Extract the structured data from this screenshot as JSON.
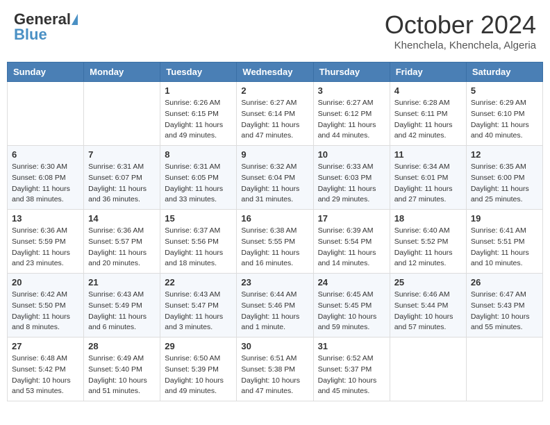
{
  "header": {
    "logo_general": "General",
    "logo_blue": "Blue",
    "month_title": "October 2024",
    "subtitle": "Khenchela, Khenchela, Algeria"
  },
  "days_of_week": [
    "Sunday",
    "Monday",
    "Tuesday",
    "Wednesday",
    "Thursday",
    "Friday",
    "Saturday"
  ],
  "weeks": [
    [
      {
        "day": "",
        "sunrise": "",
        "sunset": "",
        "daylight": ""
      },
      {
        "day": "",
        "sunrise": "",
        "sunset": "",
        "daylight": ""
      },
      {
        "day": "1",
        "sunrise": "Sunrise: 6:26 AM",
        "sunset": "Sunset: 6:15 PM",
        "daylight": "Daylight: 11 hours and 49 minutes."
      },
      {
        "day": "2",
        "sunrise": "Sunrise: 6:27 AM",
        "sunset": "Sunset: 6:14 PM",
        "daylight": "Daylight: 11 hours and 47 minutes."
      },
      {
        "day": "3",
        "sunrise": "Sunrise: 6:27 AM",
        "sunset": "Sunset: 6:12 PM",
        "daylight": "Daylight: 11 hours and 44 minutes."
      },
      {
        "day": "4",
        "sunrise": "Sunrise: 6:28 AM",
        "sunset": "Sunset: 6:11 PM",
        "daylight": "Daylight: 11 hours and 42 minutes."
      },
      {
        "day": "5",
        "sunrise": "Sunrise: 6:29 AM",
        "sunset": "Sunset: 6:10 PM",
        "daylight": "Daylight: 11 hours and 40 minutes."
      }
    ],
    [
      {
        "day": "6",
        "sunrise": "Sunrise: 6:30 AM",
        "sunset": "Sunset: 6:08 PM",
        "daylight": "Daylight: 11 hours and 38 minutes."
      },
      {
        "day": "7",
        "sunrise": "Sunrise: 6:31 AM",
        "sunset": "Sunset: 6:07 PM",
        "daylight": "Daylight: 11 hours and 36 minutes."
      },
      {
        "day": "8",
        "sunrise": "Sunrise: 6:31 AM",
        "sunset": "Sunset: 6:05 PM",
        "daylight": "Daylight: 11 hours and 33 minutes."
      },
      {
        "day": "9",
        "sunrise": "Sunrise: 6:32 AM",
        "sunset": "Sunset: 6:04 PM",
        "daylight": "Daylight: 11 hours and 31 minutes."
      },
      {
        "day": "10",
        "sunrise": "Sunrise: 6:33 AM",
        "sunset": "Sunset: 6:03 PM",
        "daylight": "Daylight: 11 hours and 29 minutes."
      },
      {
        "day": "11",
        "sunrise": "Sunrise: 6:34 AM",
        "sunset": "Sunset: 6:01 PM",
        "daylight": "Daylight: 11 hours and 27 minutes."
      },
      {
        "day": "12",
        "sunrise": "Sunrise: 6:35 AM",
        "sunset": "Sunset: 6:00 PM",
        "daylight": "Daylight: 11 hours and 25 minutes."
      }
    ],
    [
      {
        "day": "13",
        "sunrise": "Sunrise: 6:36 AM",
        "sunset": "Sunset: 5:59 PM",
        "daylight": "Daylight: 11 hours and 23 minutes."
      },
      {
        "day": "14",
        "sunrise": "Sunrise: 6:36 AM",
        "sunset": "Sunset: 5:57 PM",
        "daylight": "Daylight: 11 hours and 20 minutes."
      },
      {
        "day": "15",
        "sunrise": "Sunrise: 6:37 AM",
        "sunset": "Sunset: 5:56 PM",
        "daylight": "Daylight: 11 hours and 18 minutes."
      },
      {
        "day": "16",
        "sunrise": "Sunrise: 6:38 AM",
        "sunset": "Sunset: 5:55 PM",
        "daylight": "Daylight: 11 hours and 16 minutes."
      },
      {
        "day": "17",
        "sunrise": "Sunrise: 6:39 AM",
        "sunset": "Sunset: 5:54 PM",
        "daylight": "Daylight: 11 hours and 14 minutes."
      },
      {
        "day": "18",
        "sunrise": "Sunrise: 6:40 AM",
        "sunset": "Sunset: 5:52 PM",
        "daylight": "Daylight: 11 hours and 12 minutes."
      },
      {
        "day": "19",
        "sunrise": "Sunrise: 6:41 AM",
        "sunset": "Sunset: 5:51 PM",
        "daylight": "Daylight: 11 hours and 10 minutes."
      }
    ],
    [
      {
        "day": "20",
        "sunrise": "Sunrise: 6:42 AM",
        "sunset": "Sunset: 5:50 PM",
        "daylight": "Daylight: 11 hours and 8 minutes."
      },
      {
        "day": "21",
        "sunrise": "Sunrise: 6:43 AM",
        "sunset": "Sunset: 5:49 PM",
        "daylight": "Daylight: 11 hours and 6 minutes."
      },
      {
        "day": "22",
        "sunrise": "Sunrise: 6:43 AM",
        "sunset": "Sunset: 5:47 PM",
        "daylight": "Daylight: 11 hours and 3 minutes."
      },
      {
        "day": "23",
        "sunrise": "Sunrise: 6:44 AM",
        "sunset": "Sunset: 5:46 PM",
        "daylight": "Daylight: 11 hours and 1 minute."
      },
      {
        "day": "24",
        "sunrise": "Sunrise: 6:45 AM",
        "sunset": "Sunset: 5:45 PM",
        "daylight": "Daylight: 10 hours and 59 minutes."
      },
      {
        "day": "25",
        "sunrise": "Sunrise: 6:46 AM",
        "sunset": "Sunset: 5:44 PM",
        "daylight": "Daylight: 10 hours and 57 minutes."
      },
      {
        "day": "26",
        "sunrise": "Sunrise: 6:47 AM",
        "sunset": "Sunset: 5:43 PM",
        "daylight": "Daylight: 10 hours and 55 minutes."
      }
    ],
    [
      {
        "day": "27",
        "sunrise": "Sunrise: 6:48 AM",
        "sunset": "Sunset: 5:42 PM",
        "daylight": "Daylight: 10 hours and 53 minutes."
      },
      {
        "day": "28",
        "sunrise": "Sunrise: 6:49 AM",
        "sunset": "Sunset: 5:40 PM",
        "daylight": "Daylight: 10 hours and 51 minutes."
      },
      {
        "day": "29",
        "sunrise": "Sunrise: 6:50 AM",
        "sunset": "Sunset: 5:39 PM",
        "daylight": "Daylight: 10 hours and 49 minutes."
      },
      {
        "day": "30",
        "sunrise": "Sunrise: 6:51 AM",
        "sunset": "Sunset: 5:38 PM",
        "daylight": "Daylight: 10 hours and 47 minutes."
      },
      {
        "day": "31",
        "sunrise": "Sunrise: 6:52 AM",
        "sunset": "Sunset: 5:37 PM",
        "daylight": "Daylight: 10 hours and 45 minutes."
      },
      {
        "day": "",
        "sunrise": "",
        "sunset": "",
        "daylight": ""
      },
      {
        "day": "",
        "sunrise": "",
        "sunset": "",
        "daylight": ""
      }
    ]
  ]
}
